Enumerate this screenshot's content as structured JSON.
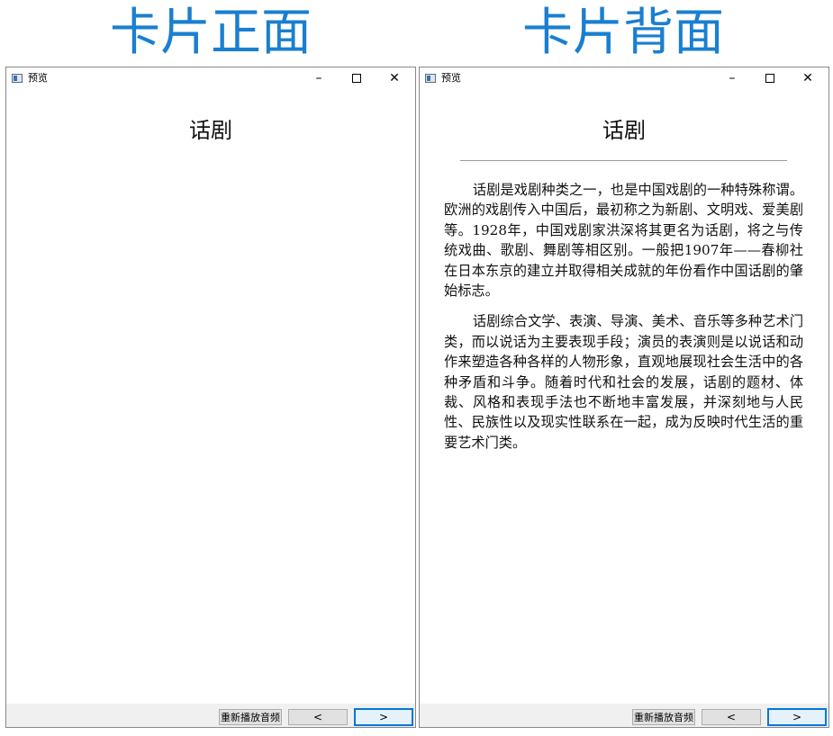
{
  "headings": {
    "front": "卡片正面",
    "back": "卡片背面"
  },
  "window": {
    "title": "预览",
    "minimize": "–",
    "close": "✕"
  },
  "card": {
    "title": "话剧",
    "paragraphs": [
      "话剧是戏剧种类之一，也是中国戏剧的一种特殊称谓。欧洲的戏剧传入中国后，最初称之为新剧、文明戏、爱美剧等。1928年，中国戏剧家洪深将其更名为话剧，将之与传统戏曲、歌剧、舞剧等相区别。一般把1907年——春柳社在日本东京的建立并取得相关成就的年份看作中国话剧的肇始标志。",
      "话剧综合文学、表演、导演、美术、音乐等多种艺术门类，而以说话为主要表现手段；演员的表演则是以说话和动作来塑造各种各样的人物形象，直观地展现社会生活中的各种矛盾和斗争。随着时代和社会的发展，话剧的题材、体裁、风格和表现手法也不断地丰富发展，并深刻地与人民性、民族性以及现实性联系在一起，成为反映时代生活的重要艺术门类。"
    ]
  },
  "buttons": {
    "replay": "重新播放音频",
    "prev": "<",
    "next": ">"
  }
}
